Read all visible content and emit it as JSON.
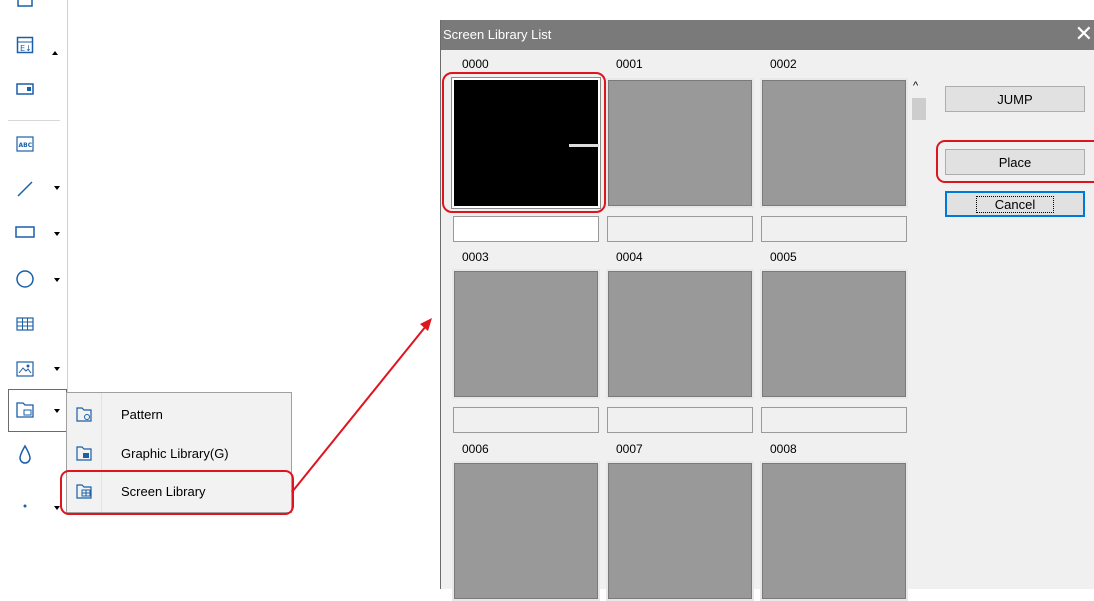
{
  "toolbar": {
    "icons": [
      "table-icon",
      "display-icon",
      "text-icon",
      "line-icon",
      "rectangle-icon",
      "circle-icon",
      "grid-icon",
      "image-icon",
      "library-icon",
      "fill-icon",
      "dot-icon"
    ]
  },
  "menu": {
    "items": [
      {
        "label": "Pattern",
        "icon": "pattern-icon"
      },
      {
        "label": "Graphic Library(G)",
        "icon": "graphic-library-icon"
      },
      {
        "label": "Screen Library",
        "icon": "screen-library-icon"
      }
    ]
  },
  "dialog": {
    "title": "Screen Library List",
    "close_glyph": "✕",
    "cells": [
      {
        "num": "0000"
      },
      {
        "num": "0001"
      },
      {
        "num": "0002"
      },
      {
        "num": "0003"
      },
      {
        "num": "0004"
      },
      {
        "num": "0005"
      },
      {
        "num": "0006"
      },
      {
        "num": "0007"
      },
      {
        "num": "0008"
      }
    ],
    "buttons": {
      "jump": "JUMP",
      "place": "Place",
      "cancel": "Cancel"
    },
    "scroll_up": "^"
  },
  "colors": {
    "highlight": "#e0141e",
    "titlebar": "#7a7a7a",
    "thumb": "#999999"
  }
}
